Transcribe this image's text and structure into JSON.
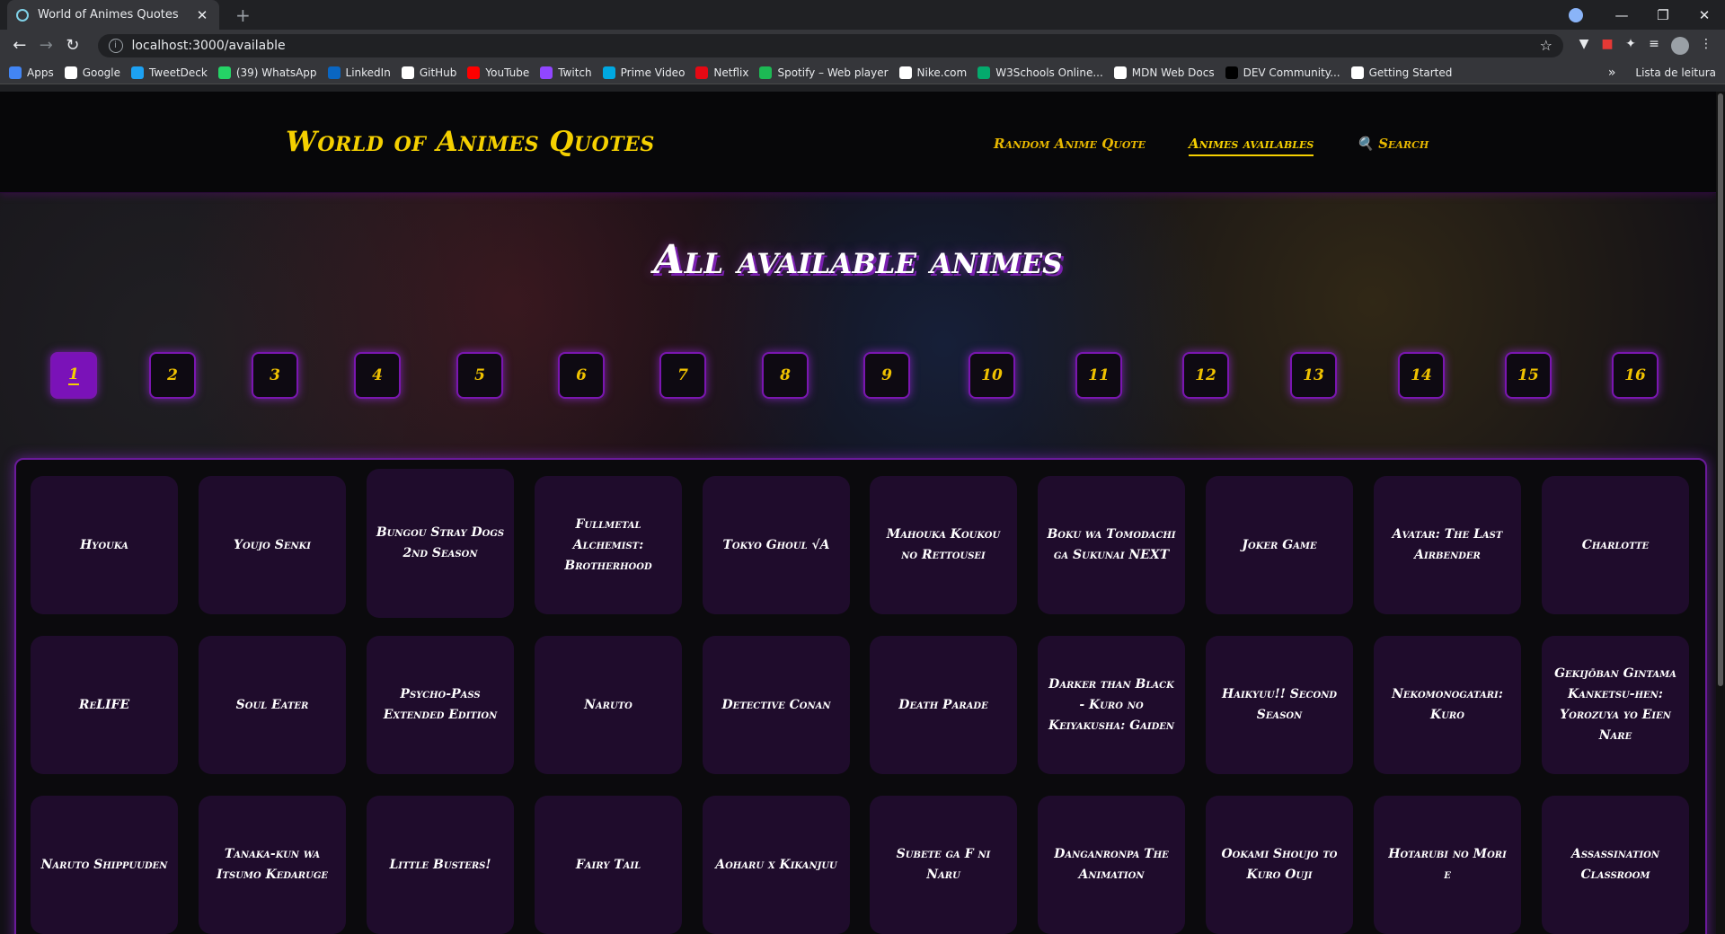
{
  "browser": {
    "tab_title": "World of Animes Quotes",
    "url": "localhost:3000/available",
    "bookmarks": [
      {
        "label": "Apps",
        "color": "#4285f4"
      },
      {
        "label": "Google",
        "color": "#ffffff"
      },
      {
        "label": "TweetDeck",
        "color": "#1da1f2"
      },
      {
        "label": "(39) WhatsApp",
        "color": "#25d366"
      },
      {
        "label": "LinkedIn",
        "color": "#0a66c2"
      },
      {
        "label": "GitHub",
        "color": "#ffffff"
      },
      {
        "label": "YouTube",
        "color": "#ff0000"
      },
      {
        "label": "Twitch",
        "color": "#9146ff"
      },
      {
        "label": "Prime Video",
        "color": "#00a8e1"
      },
      {
        "label": "Netflix",
        "color": "#e50914"
      },
      {
        "label": "Spotify – Web player",
        "color": "#1db954"
      },
      {
        "label": "Nike.com",
        "color": "#ffffff"
      },
      {
        "label": "W3Schools Online...",
        "color": "#04aa6d"
      },
      {
        "label": "MDN Web Docs",
        "color": "#ffffff"
      },
      {
        "label": "DEV Community...",
        "color": "#000000"
      },
      {
        "label": "Getting Started",
        "color": "#ffffff"
      }
    ],
    "reading_list": "Lista de leitura"
  },
  "site": {
    "title": "World of Animes Quotes",
    "nav": [
      {
        "label": "Random Anime Quote",
        "active": false
      },
      {
        "label": "Animes availables",
        "active": true
      },
      {
        "label": "🔍 Search",
        "active": false
      }
    ],
    "heading": "All available animes",
    "pages": [
      "1",
      "2",
      "3",
      "4",
      "5",
      "6",
      "7",
      "8",
      "9",
      "10",
      "11",
      "12",
      "13",
      "14",
      "15",
      "16"
    ],
    "current_page": "1",
    "animes": [
      "Hyouka",
      "Youjo Senki",
      "Bungou Stray Dogs 2nd Season",
      "Fullmetal Alchemist: Brotherhood",
      "Tokyo Ghoul √A",
      "Mahouka Koukou no Rettousei",
      "Boku wa Tomodachi ga Sukunai NEXT",
      "Joker Game",
      "Avatar: The Last Airbender",
      "Charlotte",
      "ReLIFE",
      "Soul Eater",
      "Psycho-Pass Extended Edition",
      "Naruto",
      "Detective Conan",
      "Death Parade",
      "Darker than Black - Kuro no Keiyakusha: Gaiden",
      "Haikyuu!! Second Season",
      "Nekomonogatari: Kuro",
      "Gekijōban Gintama Kanketsu-hen: Yorozuya yo Eien Nare",
      "Naruto Shippuuden",
      "Tanaka-kun wa Itsumo Kedaruge",
      "Little Busters!",
      "Fairy Tail",
      "Aoharu x Kikanjuu",
      "Subete ga F ni Naru",
      "Danganronpa The Animation",
      "Ookami Shoujo to Kuro Ouji",
      "Hotarubi no Mori e",
      "Assassination Classroom"
    ]
  }
}
